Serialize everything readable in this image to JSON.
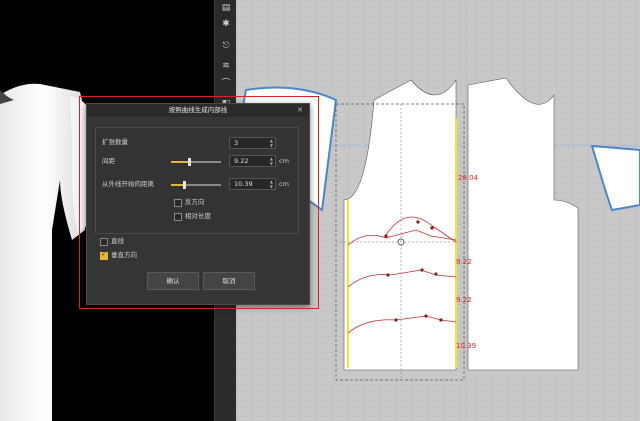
{
  "dialog": {
    "title": "按照曲线生成内部线",
    "close_icon": "✕",
    "fields": {
      "expand_count": {
        "label": "扩张数量",
        "value": "3"
      },
      "spacing": {
        "label": "间距",
        "value": "9.22",
        "unit": "cm",
        "slider_fraction": 0.35
      },
      "outer_distance": {
        "label": "从外线开始的距离",
        "value": "10.39",
        "unit": "cm",
        "slider_fraction": 0.25
      }
    },
    "options": {
      "reverse": {
        "label": "反方向",
        "checked": false
      },
      "relative_length": {
        "label": "相对长度",
        "checked": false
      },
      "straight_line": {
        "label": "直线",
        "checked": false
      },
      "vertical_direction": {
        "label": "垂直方向",
        "checked": true
      }
    },
    "buttons": {
      "confirm": "确认",
      "cancel": "取消"
    }
  },
  "pattern": {
    "annotations": [
      "28.04",
      "9.22",
      "9.22",
      "10.39"
    ]
  },
  "colors": {
    "highlight_yellow": "#f2e23a",
    "curve_red": "#c03030",
    "selection_red": "#e02020",
    "accent": "#e5b53a"
  }
}
